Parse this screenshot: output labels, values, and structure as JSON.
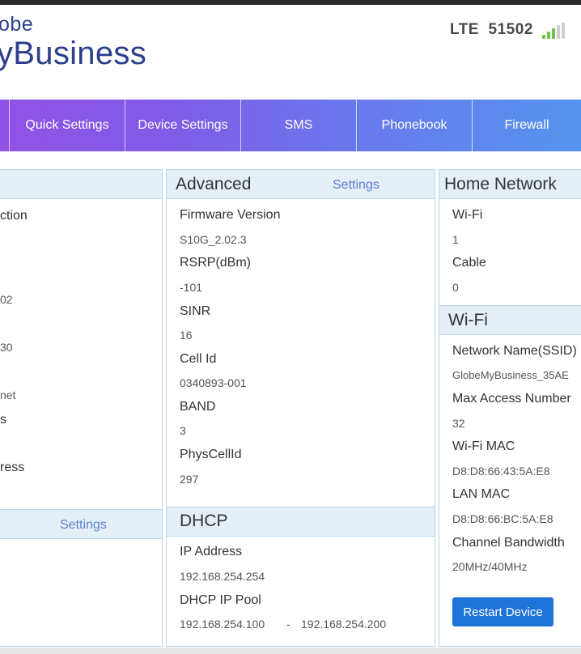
{
  "brand": {
    "line1": "obe",
    "line2": "yBusiness"
  },
  "status": {
    "network_label": "LTE",
    "network_code": "51502",
    "signal_icon": "signal-bars-icon"
  },
  "nav": {
    "items": [
      {
        "label": ""
      },
      {
        "label": "Quick Settings"
      },
      {
        "label": "Device Settings"
      },
      {
        "label": "SMS"
      },
      {
        "label": "Phonebook"
      },
      {
        "label": "Firewall"
      }
    ]
  },
  "left_panel": {
    "row_labels": [
      "ction",
      "02",
      "30",
      "net",
      "s",
      "ress"
    ],
    "settings_link": "Settings"
  },
  "advanced": {
    "title": "Advanced",
    "settings_link": "Settings",
    "fields": [
      {
        "label": "Firmware Version",
        "value": "S10G_2.02.3"
      },
      {
        "label": "RSRP(dBm)",
        "value": "-101"
      },
      {
        "label": "SINR",
        "value": "16"
      },
      {
        "label": "Cell Id",
        "value": "0340893-001"
      },
      {
        "label": "BAND",
        "value": "3"
      },
      {
        "label": "PhysCellId",
        "value": "297"
      }
    ]
  },
  "dhcp": {
    "title": "DHCP",
    "ip_address_label": "IP Address",
    "ip_address_value": "192.168.254.254",
    "pool_label": "DHCP IP Pool",
    "pool_start": "192.168.254.100",
    "pool_separator": "-",
    "pool_end": "192.168.254.200"
  },
  "home_network": {
    "title": "Home Network",
    "fields": [
      {
        "label": "Wi-Fi",
        "value": "1"
      },
      {
        "label": "Cable",
        "value": "0"
      }
    ]
  },
  "wifi": {
    "title": "Wi-Fi",
    "fields": [
      {
        "label": "Network Name(SSID)",
        "value": "GlobeMyBusiness_35AE"
      },
      {
        "label": "Max Access Number",
        "value": "32"
      },
      {
        "label": "Wi-Fi MAC",
        "value": "D8:D8:66:43:5A:E8"
      },
      {
        "label": "LAN MAC",
        "value": "D8:D8:66:BC:5A:E8"
      },
      {
        "label": "Channel Bandwidth",
        "value": "20MHz/40MHz"
      }
    ],
    "restart_button": "Restart Device"
  },
  "colors": {
    "brand_blue": "#2b3f8c",
    "nav_gradient_start": "#9152e6",
    "nav_gradient_end": "#5594ef",
    "panel_header_bg": "#e4eff8",
    "link_blue": "#5a7fd0",
    "button_blue": "#1e73d8",
    "signal_green": "#6cc644"
  }
}
